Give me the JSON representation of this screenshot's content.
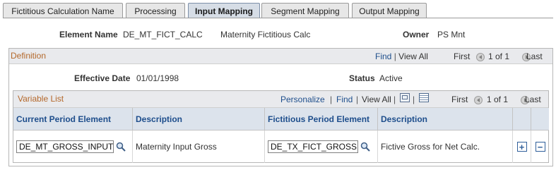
{
  "tabs": [
    {
      "label": "Fictitious Calculation Name"
    },
    {
      "label": "Processing"
    },
    {
      "label": "Input Mapping"
    },
    {
      "label": "Segment Mapping"
    },
    {
      "label": "Output Mapping"
    }
  ],
  "header": {
    "element_name_label": "Element Name",
    "element_name_value": "DE_MT_FICT_CALC",
    "element_description": "Maternity Fictitious Calc",
    "owner_label": "Owner",
    "owner_value": "PS Mnt"
  },
  "definition": {
    "title": "Definition",
    "find": "Find",
    "view_all": "View All",
    "first": "First",
    "range": "1 of 1",
    "last": "Last",
    "effective_date_label": "Effective Date",
    "effective_date_value": "01/01/1998",
    "status_label": "Status",
    "status_value": "Active"
  },
  "variable_list": {
    "title": "Variable List",
    "personalize": "Personalize",
    "find": "Find",
    "view_all": "View All",
    "first": "First",
    "range": "1 of 1",
    "last": "Last",
    "columns": [
      "Current Period Element",
      "Description",
      "Fictitious Period Element",
      "Description"
    ],
    "rows": [
      {
        "current_period_element": "DE_MT_GROSS_INPUT",
        "description": "Maternity Input Gross",
        "fictitious_period_element": "DE_TX_FICT_GROSS",
        "fictitious_description": "Fictive Gross for Net Calc."
      }
    ]
  },
  "icons": {
    "lookup": "magnifier-icon",
    "add_row": "plus-icon",
    "delete_row": "minus-icon",
    "zoom": "zoom-icon",
    "download": "spreadsheet-icon"
  }
}
